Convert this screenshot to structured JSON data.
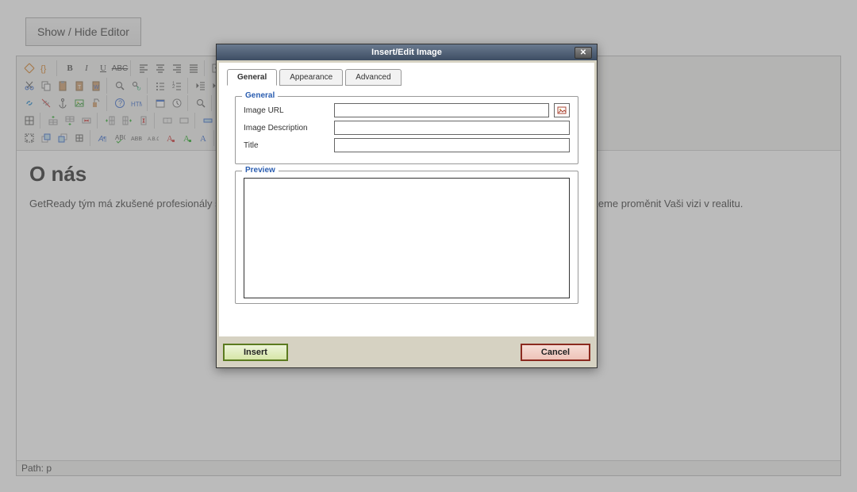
{
  "page": {
    "show_hide_label": "Show / Hide Editor",
    "content_heading": "O nás",
    "content_paragraph": "GetReady tým má zkušené profesionály s vášní pro práci, kteří dotlačí vaše projekty a podnikání do zdárného konce. Pomůžeme proměnit Vaši vizi v realitu.",
    "path_label": "Path:",
    "path_value": "p"
  },
  "dialog": {
    "title": "Insert/Edit Image",
    "tabs": {
      "general": "General",
      "appearance": "Appearance",
      "advanced": "Advanced"
    },
    "fieldset_general": "General",
    "fieldset_preview": "Preview",
    "labels": {
      "url": "Image URL",
      "desc": "Image Description",
      "title": "Title"
    },
    "values": {
      "url": "",
      "desc": "",
      "title": ""
    },
    "buttons": {
      "insert": "Insert",
      "cancel": "Cancel"
    }
  },
  "icons": {
    "bold": "B",
    "italic": "I",
    "underline": "U",
    "strike": "ABC"
  }
}
